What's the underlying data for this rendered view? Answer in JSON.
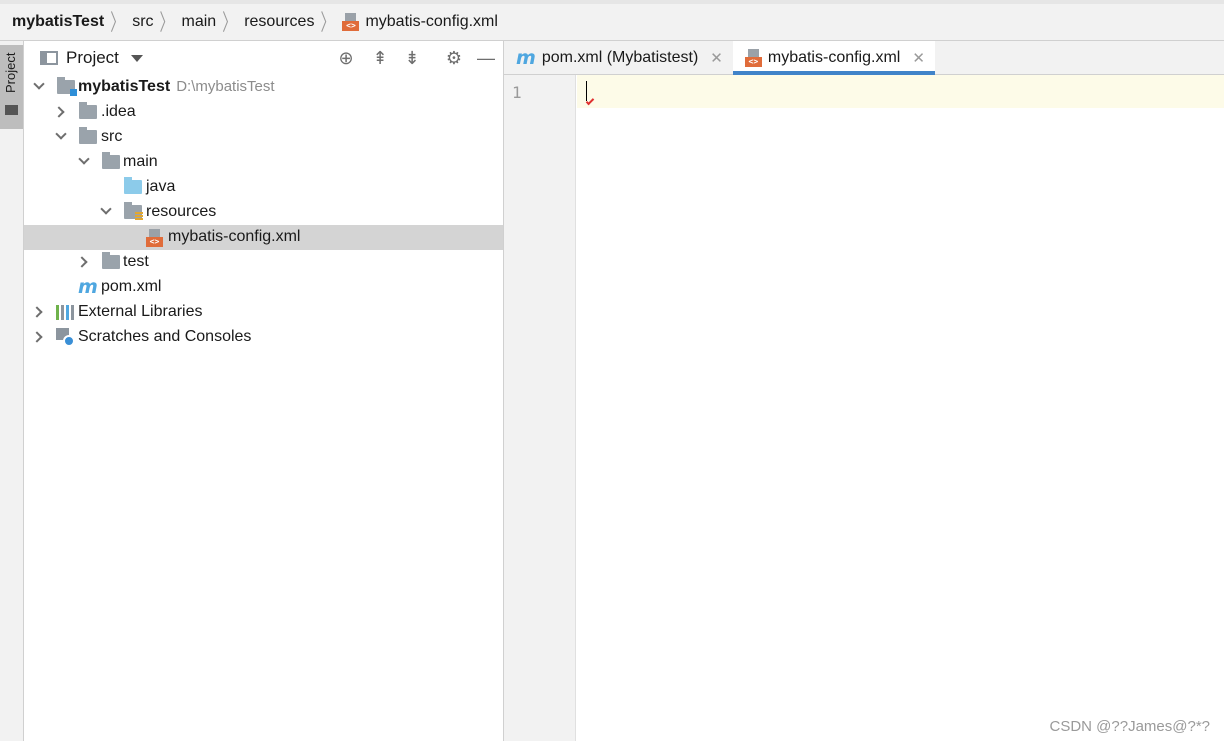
{
  "breadcrumb": {
    "items": [
      "mybatisTest",
      "src",
      "main",
      "resources"
    ],
    "file": "mybatis-config.xml",
    "file_icon": "xml-file-icon"
  },
  "left_stripe": {
    "project_label": "Project"
  },
  "project_panel": {
    "title": "Project",
    "tools": [
      "locate-icon",
      "expand-all-icon",
      "collapse-all-icon",
      "gear-icon",
      "minimize-icon"
    ]
  },
  "tree": {
    "root": {
      "label": "mybatisTest",
      "path": "D:\\mybatisTest"
    },
    "idea": ".idea",
    "src": "src",
    "main": "main",
    "java": "java",
    "resources": "resources",
    "config": "mybatis-config.xml",
    "test": "test",
    "pom": "pom.xml",
    "external": "External Libraries",
    "scratches": "Scratches and Consoles"
  },
  "editor": {
    "tabs": [
      {
        "label": "pom.xml (Mybatistest)",
        "icon": "maven-icon",
        "active": false
      },
      {
        "label": "mybatis-config.xml",
        "icon": "xml-file-icon",
        "active": true
      }
    ],
    "line_number": "1"
  },
  "watermark": "CSDN @??James@?*?"
}
